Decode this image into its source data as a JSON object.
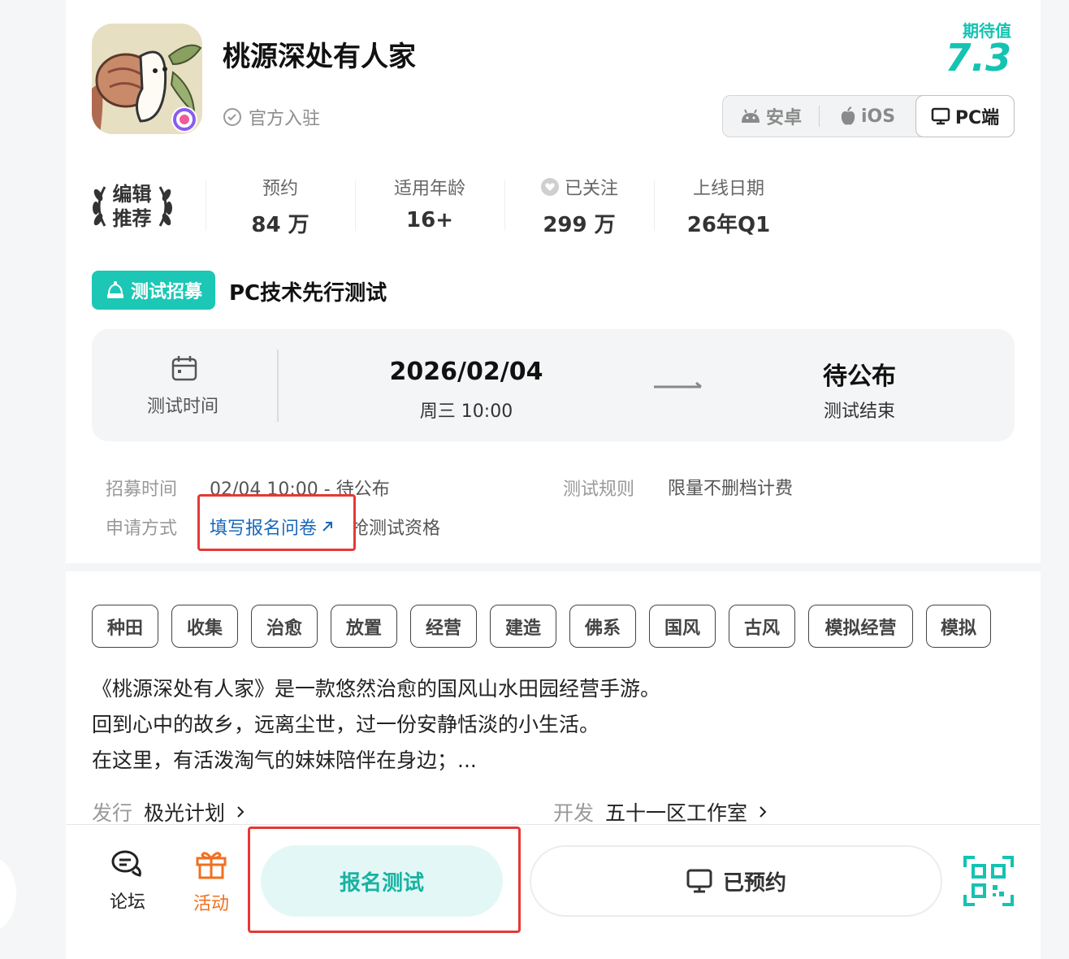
{
  "app": {
    "name": "桃源深处有人家",
    "official_label": "官方入驻",
    "expectation_label": "期待值",
    "expectation_value": "7.3"
  },
  "platforms": [
    {
      "label": "安卓",
      "icon": "android-icon",
      "active": false
    },
    {
      "label": "iOS",
      "icon": "apple-icon",
      "active": false
    },
    {
      "label": "PC端",
      "icon": "monitor-icon",
      "active": true
    }
  ],
  "editor_badge": {
    "line1": "编辑",
    "line2": "推荐"
  },
  "stats": [
    {
      "label": "预约",
      "value": "84 万"
    },
    {
      "label": "适用年龄",
      "value": "16+"
    },
    {
      "label": "已关注",
      "value": "299 万",
      "icon": "heart-icon"
    },
    {
      "label": "上线日期",
      "value": "26年Q1"
    }
  ],
  "test": {
    "badge": "测试招募",
    "title": "PC技术先行测试",
    "time_label": "测试时间",
    "start_date": "2026/02/04",
    "start_sub": "周三 10:00",
    "end_title": "待公布",
    "end_sub": "测试结束",
    "recruit_label": "招募时间",
    "recruit_value": "02/04 10:00 - 待公布",
    "rules_label": "测试规则",
    "rules_value": "限量不删档计费",
    "apply_label": "申请方式",
    "apply_link": "填写报名问卷",
    "apply_suffix": "抢测试资格"
  },
  "tags": [
    "种田",
    "收集",
    "治愈",
    "放置",
    "经营",
    "建造",
    "佛系",
    "国风",
    "古风",
    "模拟经营",
    "模拟"
  ],
  "description": [
    "《桃源深处有人家》是一款悠然治愈的国风山水田园经营手游。",
    "回到心中的故乡，远离尘世，过一份安静恬淡的小生活。",
    "在这里，有活泼淘气的妹妹陪伴在身边；..."
  ],
  "publisher": {
    "label": "发行",
    "value": "极光计划"
  },
  "developer": {
    "label": "开发",
    "value": "五十一区工作室"
  },
  "bottom": {
    "forum_label": "论坛",
    "activity_label": "活动",
    "signup_label": "报名测试",
    "reserved_label": "已预约"
  },
  "colors": {
    "accent": "#14c3b2",
    "link": "#1a68b8",
    "highlight": "#e53935",
    "activity": "#f07020"
  }
}
